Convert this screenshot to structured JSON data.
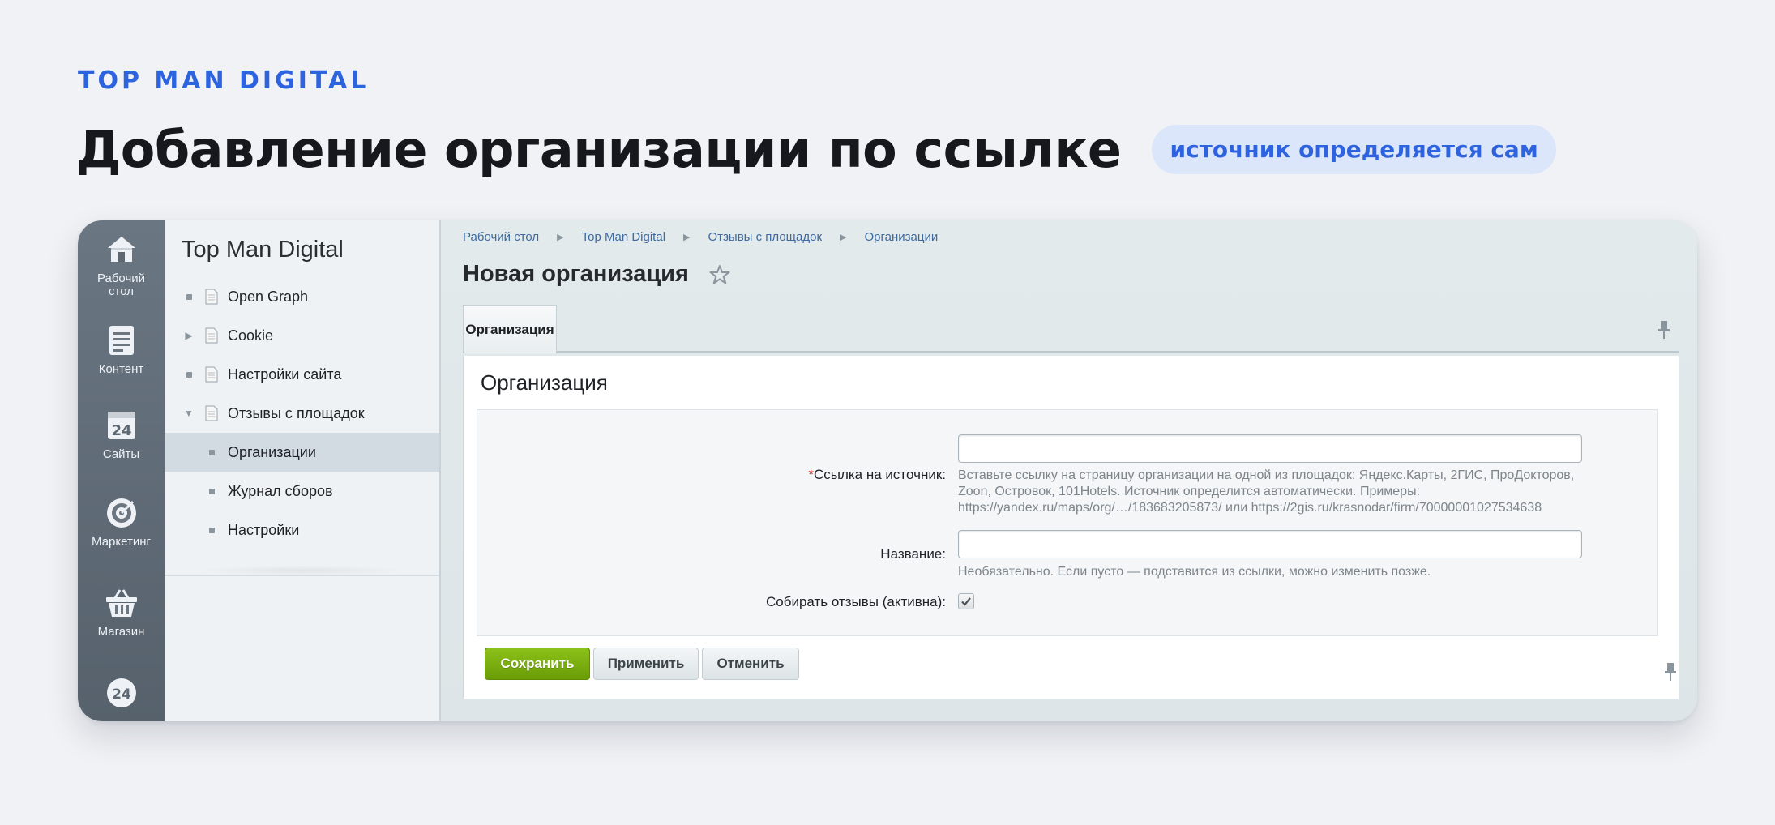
{
  "brand": "TOP MAN DIGITAL",
  "headline": "Добавление организации по ссылке",
  "badge": "источник определяется сам",
  "rail": {
    "items": [
      {
        "label": "Рабочий стол",
        "icon": "home-icon"
      },
      {
        "label": "Контент",
        "icon": "document-icon"
      },
      {
        "label": "Сайты",
        "icon": "calendar-24-icon"
      },
      {
        "label": "Маркетинг",
        "icon": "target-icon"
      },
      {
        "label": "Магазин",
        "icon": "basket-icon"
      },
      {
        "label": "",
        "icon": "clock-24-icon"
      }
    ]
  },
  "tree": {
    "title": "Top Man Digital",
    "items": [
      {
        "label": "Open Graph",
        "marker": "bullet"
      },
      {
        "label": "Cookie",
        "marker": "collapsed-arrow"
      },
      {
        "label": "Настройки сайта",
        "marker": "bullet"
      },
      {
        "label": "Отзывы с площадок",
        "marker": "expanded-arrow"
      },
      {
        "label": "Организации",
        "marker": "bullet",
        "active": true
      },
      {
        "label": "Журнал сборов",
        "marker": "bullet"
      },
      {
        "label": "Настройки",
        "marker": "bullet"
      }
    ]
  },
  "breadcrumb": [
    "Рабочий стол",
    "Top Man Digital",
    "Отзывы с площадок",
    "Организации"
  ],
  "page_title": "Новая организация",
  "tab": "Организация",
  "section_title": "Организация",
  "form": {
    "source_label": "Ссылка на источник:",
    "source_required_mark": "*",
    "source_value": "",
    "source_hint_lines": [
      "Вставьте ссылку на страницу организации на одной из площадок: Яндекс.Карты, 2ГИС, ПроДокторов,",
      "Zoon, Островок, 101Hotels. Источник определится автоматически. Примеры:",
      "https://yandex.ru/maps/org/…/183683205873/ или https://2gis.ru/krasnodar/firm/70000001027534638"
    ],
    "name_label": "Название:",
    "name_value": "",
    "name_hint": "Необязательно. Если пусто — подставится из ссылки, можно изменить позже.",
    "active_label": "Собирать отзывы (активна):",
    "active_checked": true
  },
  "buttons": {
    "save": "Сохранить",
    "apply": "Применить",
    "cancel": "Отменить"
  },
  "colors": {
    "brand": "#2e63e0",
    "save_button": "#7aad0e",
    "rail": "#5f6a75",
    "link": "#3e6aa0"
  }
}
